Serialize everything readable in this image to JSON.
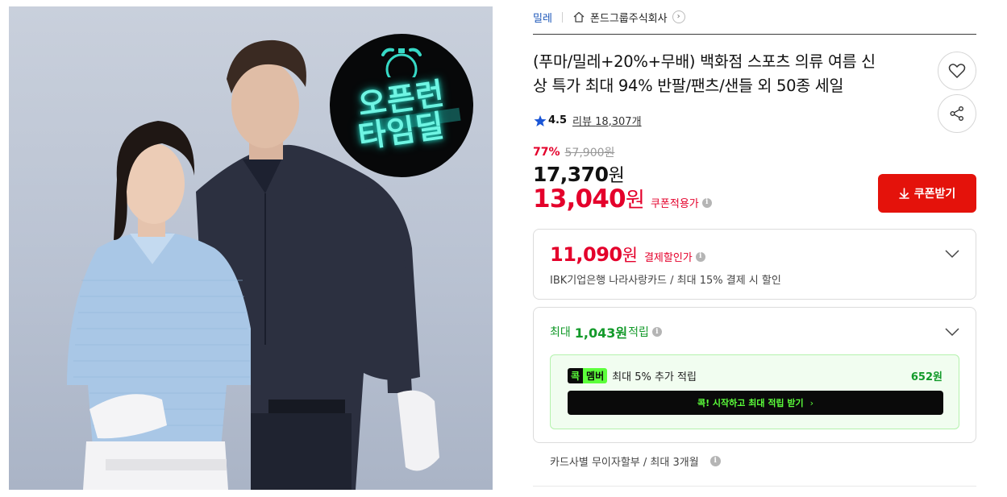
{
  "breadcrumb": {
    "brand": "밀레",
    "seller": "폰드그룹주식회사",
    "seller_chevron": "›"
  },
  "hero": {
    "badge_line1": "오픈런",
    "badge_line2": "타임딜",
    "badge_color": "#6ff5e3"
  },
  "product": {
    "title_line1": "(푸마/밀레+20%+무배) 백화점 스포츠 의류 여름 신",
    "title_line2": "상 특가 최대 94% 반팔/팬츠/샌들 외 50종 세일"
  },
  "rating": {
    "score": "4.5",
    "review_label": "리뷰",
    "review_count": "18,307개",
    "star_color": "#1a55d6"
  },
  "price": {
    "discount_rate": "77%",
    "original": "57,900원",
    "sale_num": "17,370",
    "sale_unit": "원",
    "coupon_num": "13,040",
    "coupon_unit": "원",
    "coupon_label": "쿠폰적용가",
    "accent": "#e4002b"
  },
  "coupon_button": {
    "label": "쿠폰받기",
    "color": "#e4120b"
  },
  "card_benefit": {
    "price_num": "11,090",
    "price_unit": "원",
    "label": "결제할인가",
    "description": "IBK기업은행 나라사랑카드 / 최대 15% 결제 시 할인"
  },
  "points": {
    "prefix": "최대",
    "amount": "1,043원",
    "suffix": "적립",
    "member_tag_left": "콕",
    "member_tag_right": "멤버",
    "member_text": "최대 5% 추가 적립",
    "member_amount": "652원",
    "cta_label": "콕! 시작하고 최대 적립 받기",
    "cta_arrow": "›",
    "green": "#139a2a",
    "lime": "#5cff3b"
  },
  "installment": {
    "text": "카드사별 무이자할부 / 최대 3개월"
  },
  "icons": {
    "info": "i"
  }
}
